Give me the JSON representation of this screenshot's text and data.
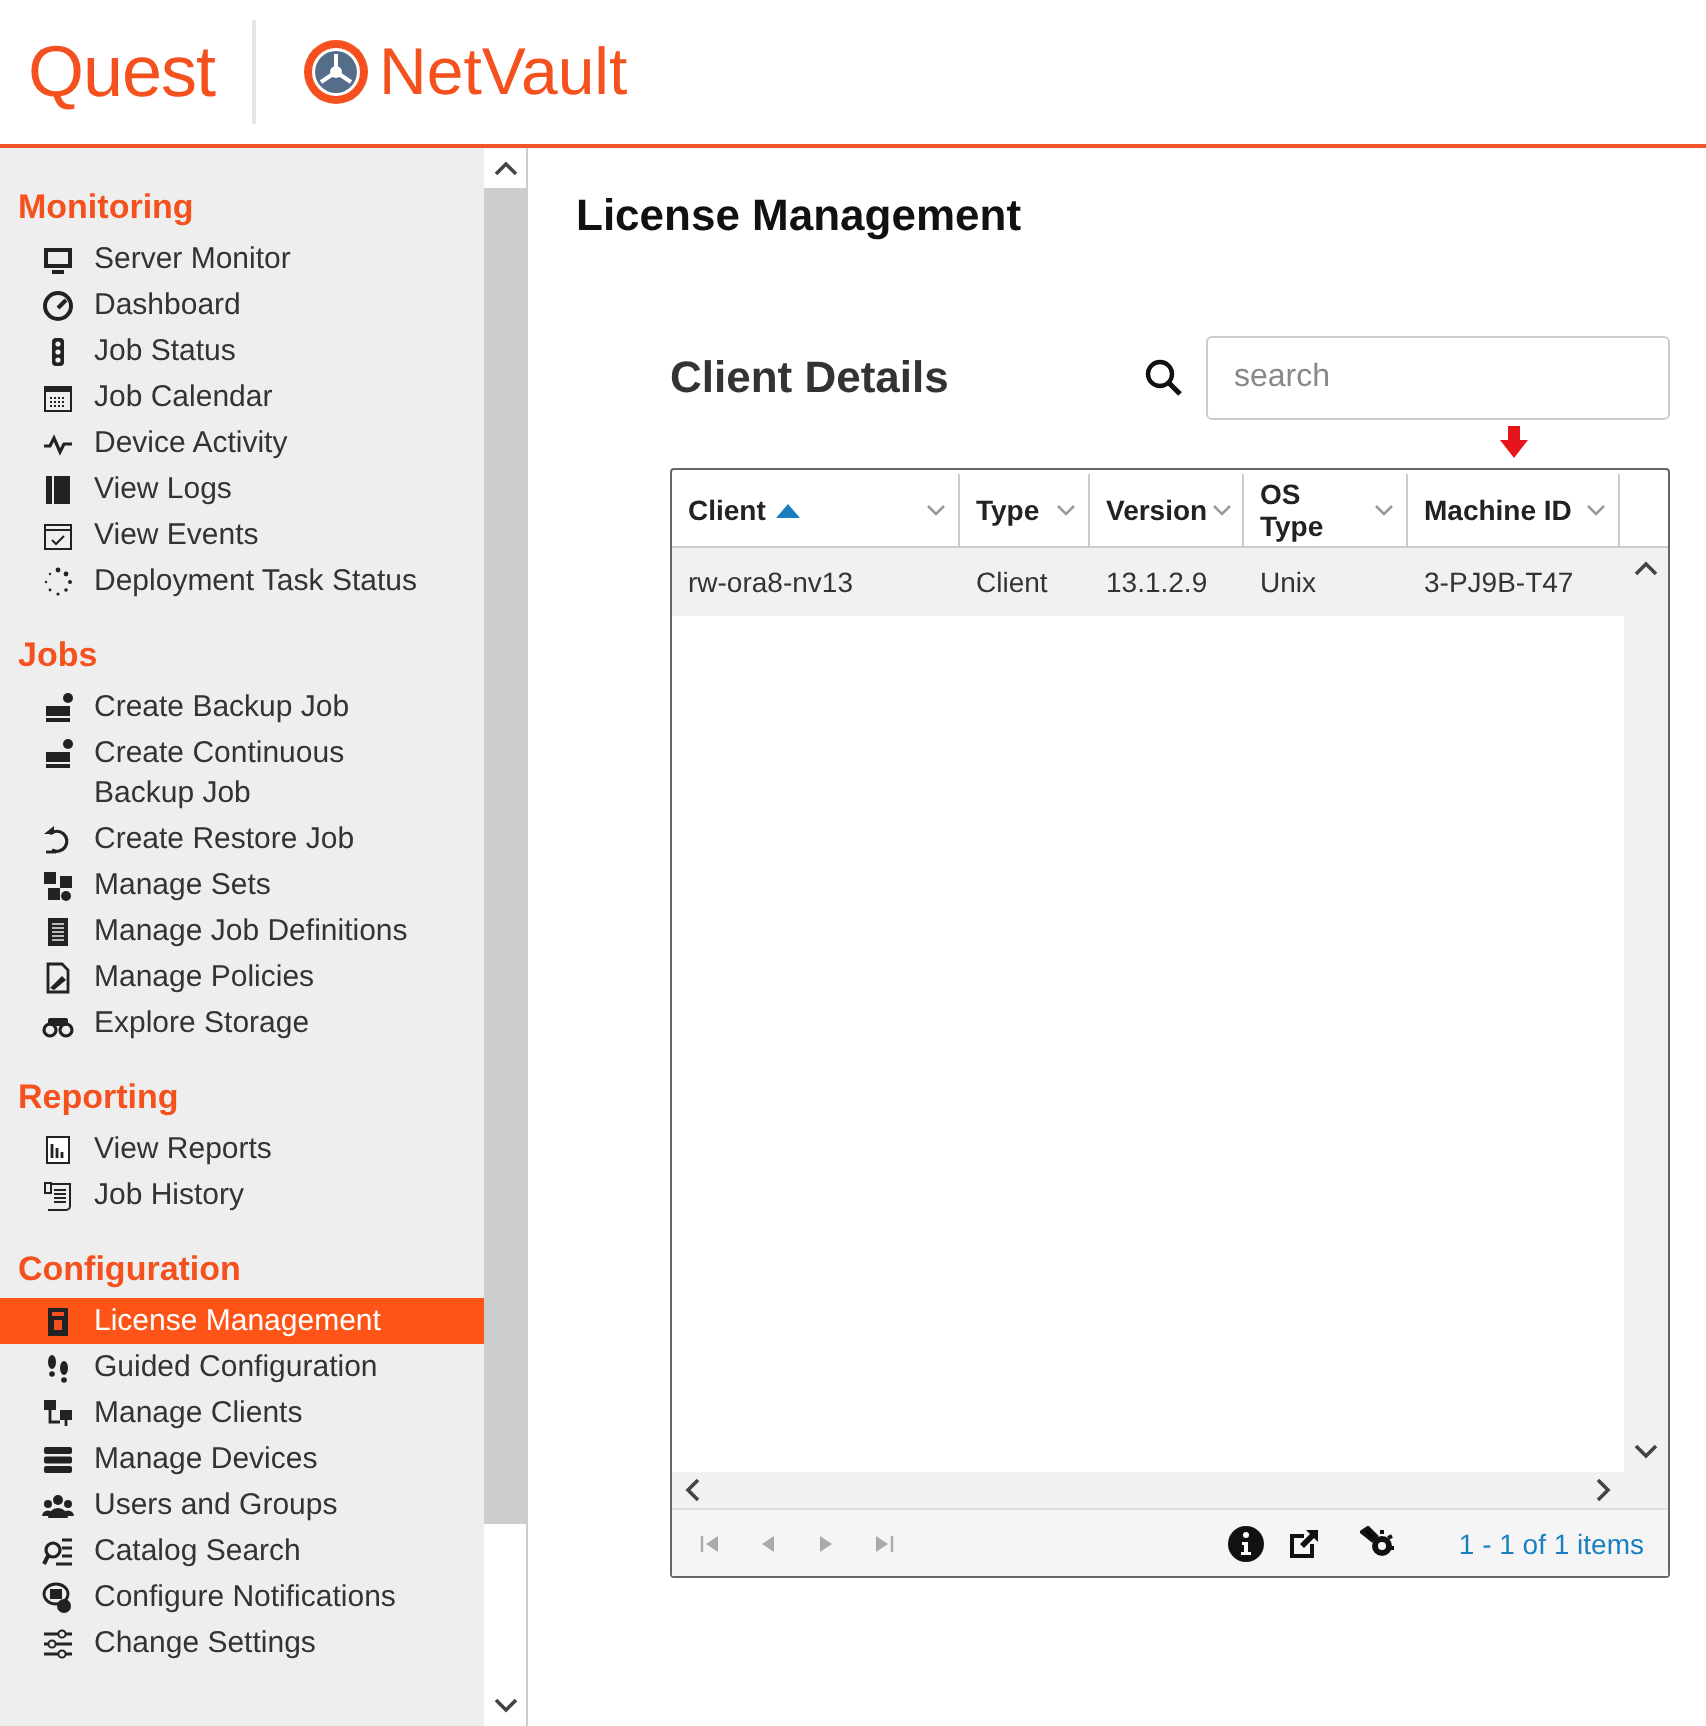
{
  "header": {
    "brand": "Quest",
    "product": "NetVault"
  },
  "sidebar": {
    "sections": [
      {
        "title": "Monitoring",
        "items": [
          {
            "label": "Server Monitor",
            "selected": false
          },
          {
            "label": "Dashboard",
            "selected": false
          },
          {
            "label": "Job Status",
            "selected": false
          },
          {
            "label": "Job Calendar",
            "selected": false
          },
          {
            "label": "Device Activity",
            "selected": false
          },
          {
            "label": "View Logs",
            "selected": false
          },
          {
            "label": "View Events",
            "selected": false
          },
          {
            "label": "Deployment Task Status",
            "selected": false
          }
        ]
      },
      {
        "title": "Jobs",
        "items": [
          {
            "label": "Create Backup Job",
            "selected": false
          },
          {
            "label": "Create Continuous Backup Job",
            "selected": false
          },
          {
            "label": "Create Restore Job",
            "selected": false
          },
          {
            "label": "Manage Sets",
            "selected": false
          },
          {
            "label": "Manage Job Definitions",
            "selected": false
          },
          {
            "label": "Manage Policies",
            "selected": false
          },
          {
            "label": "Explore Storage",
            "selected": false
          }
        ]
      },
      {
        "title": "Reporting",
        "items": [
          {
            "label": "View Reports",
            "selected": false
          },
          {
            "label": "Job History",
            "selected": false
          }
        ]
      },
      {
        "title": "Configuration",
        "items": [
          {
            "label": "License Management",
            "selected": true
          },
          {
            "label": "Guided Configuration",
            "selected": false
          },
          {
            "label": "Manage Clients",
            "selected": false
          },
          {
            "label": "Manage Devices",
            "selected": false
          },
          {
            "label": "Users and Groups",
            "selected": false
          },
          {
            "label": "Catalog Search",
            "selected": false
          },
          {
            "label": "Configure Notifications",
            "selected": false
          },
          {
            "label": "Change Settings",
            "selected": false
          }
        ]
      }
    ]
  },
  "page": {
    "title": "License Management"
  },
  "panel": {
    "title": "Client Details",
    "search": {
      "placeholder": "search"
    },
    "grid": {
      "columns": [
        {
          "label": "Client",
          "sorted": true
        },
        {
          "label": "Type",
          "sorted": false
        },
        {
          "label": "Version",
          "sorted": false
        },
        {
          "label": "OS Type",
          "sorted": false
        },
        {
          "label": "Machine ID",
          "sorted": false
        }
      ],
      "rows": [
        [
          "rw-ora8-nv13",
          "Client",
          "13.1.2.9",
          "Unix",
          "3-PJ9B-T47"
        ]
      ]
    },
    "pager": {
      "summary": "1 - 1 of 1 items"
    }
  }
}
